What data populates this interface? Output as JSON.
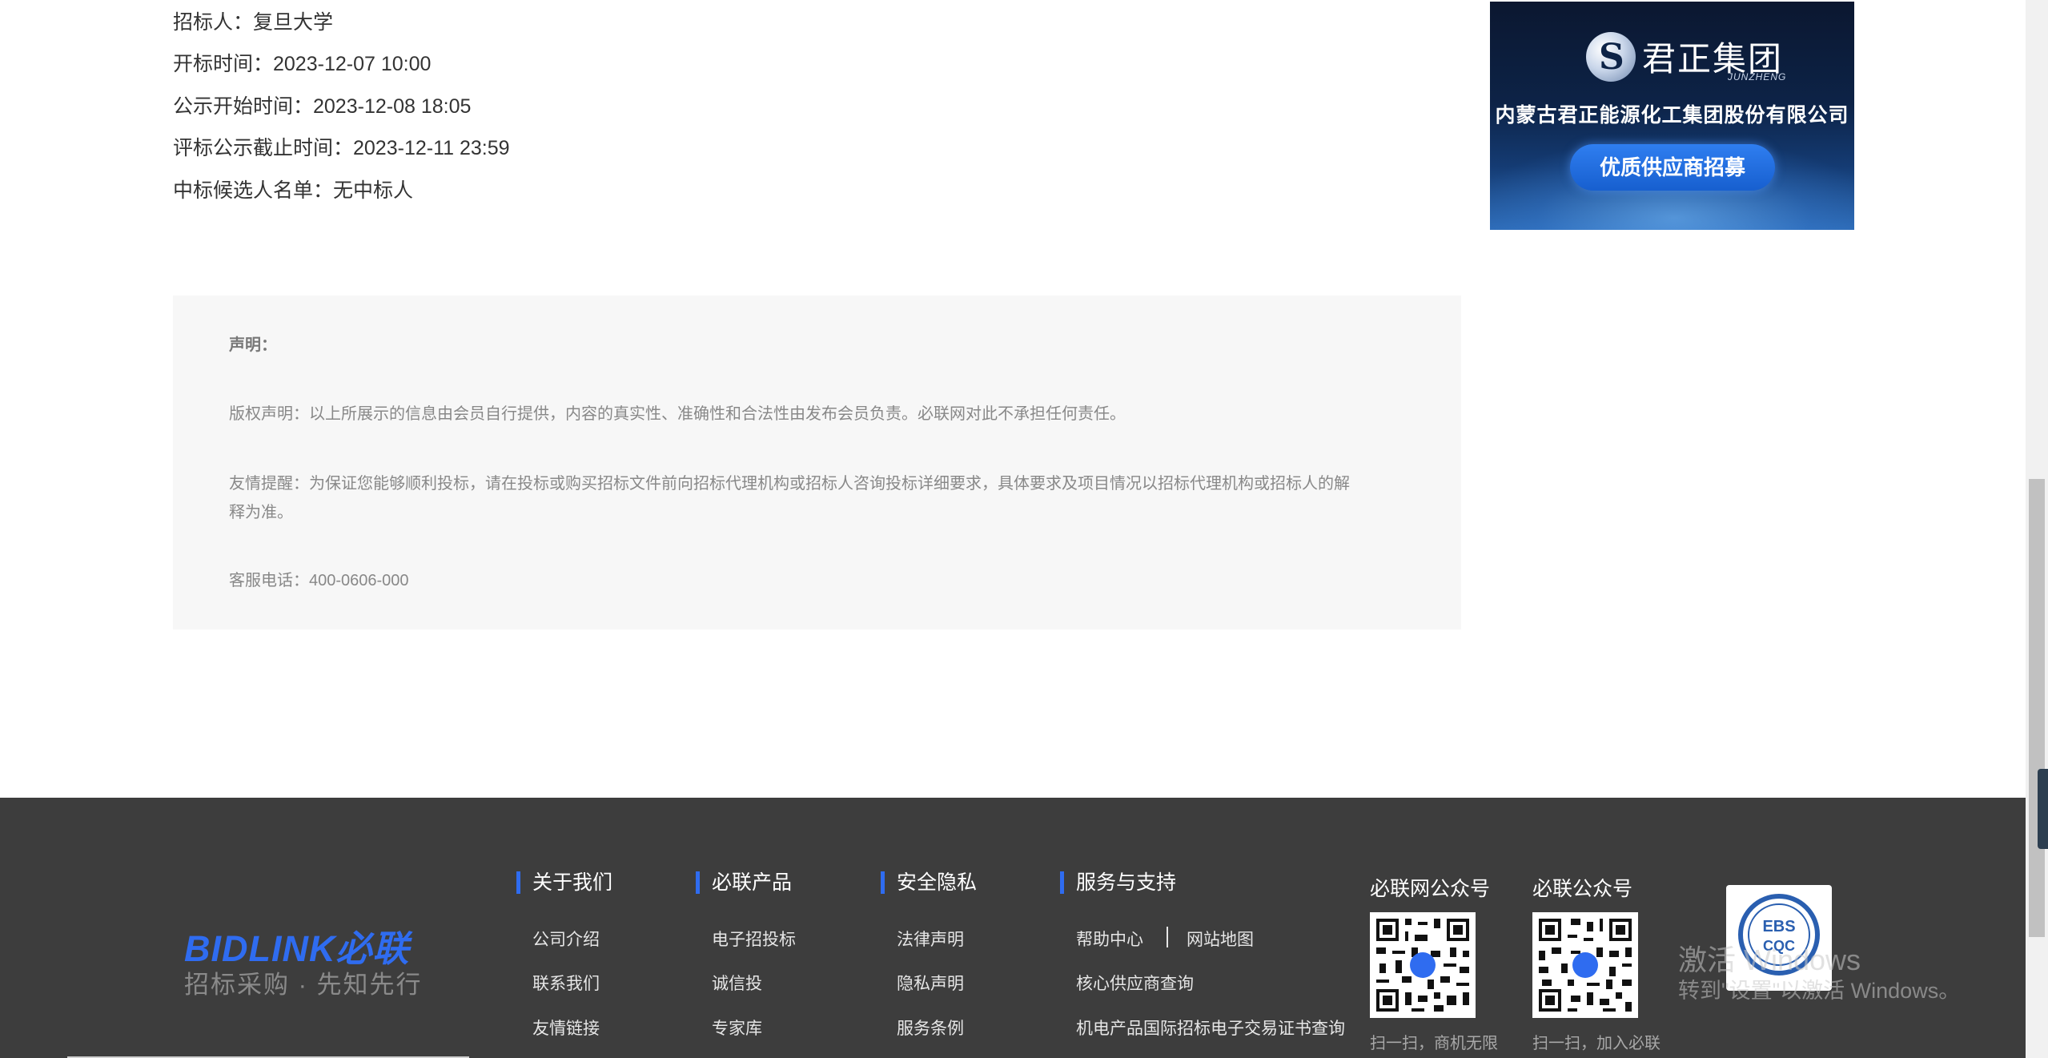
{
  "info": {
    "bidder": "招标人：复旦大学",
    "open_time": "开标时间：2023-12-07 10:00",
    "publicity_start": "公示开始时间：2023-12-08 18:05",
    "publicity_end": "评标公示截止时间：2023-12-11 23:59",
    "candidates": "中标候选人名单：无中标人"
  },
  "ad": {
    "brand": "君正集团",
    "brand_en": "JUNZHENG",
    "company": "内蒙古君正能源化工集团股份有限公司",
    "button": "优质供应商招募"
  },
  "disclaimer": {
    "heading": "声明：",
    "copyright": "版权声明：以上所展示的信息由会员自行提供，内容的真实性、准确性和合法性由发布会员负责。必联网对此不承担任何责任。",
    "reminder_line1": "友情提醒：为保证您能够顺利投标，请在投标或购买招标文件前向招标代理机构或招标人咨询投标详细要求，具体要求及项目情况以招标代理机构或招标人的解",
    "reminder_line2": "释为准。",
    "hotline": "客服电话：400-0606-000"
  },
  "footer": {
    "logo": "BIDLINK必联",
    "slogan": "招标采购 · 先知先行",
    "columns": [
      {
        "title": "关于我们",
        "links": [
          "公司介绍",
          "联系我们",
          "友情链接"
        ]
      },
      {
        "title": "必联产品",
        "links": [
          "电子招投标",
          "诚信投",
          "专家库"
        ]
      },
      {
        "title": "安全隐私",
        "links": [
          "法律声明",
          "隐私声明",
          "服务条例"
        ]
      },
      {
        "title": "服务与支持",
        "links": [
          "帮助中心",
          "网站地图",
          "核心供应商查询",
          "机电产品国际招标电子交易证书查询"
        ]
      }
    ],
    "qr": [
      {
        "title": "必联网公众号",
        "caption": "扫一扫，商机无限"
      },
      {
        "title": "必联公众号",
        "caption": "扫一扫，加入必联"
      }
    ],
    "cert_text": "EBS CQC"
  },
  "watermark": {
    "line1": "激活 Windows",
    "line2": "转到\"设置\"以激活 Windows。"
  }
}
